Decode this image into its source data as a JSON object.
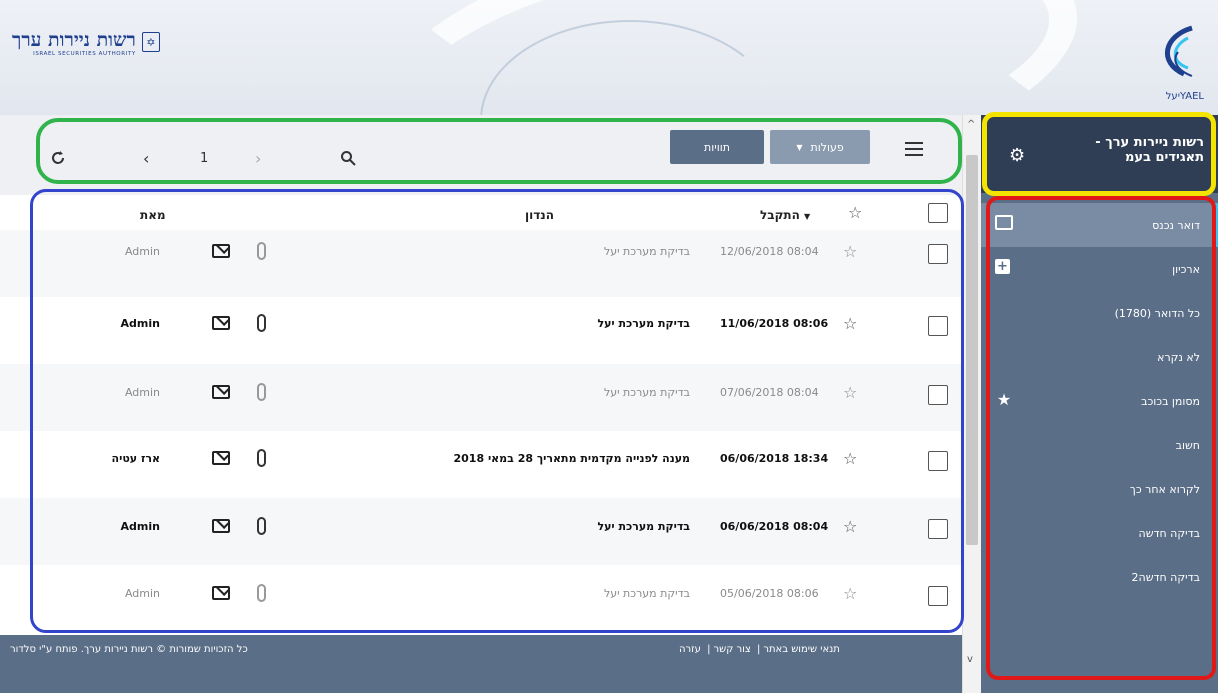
{
  "header": {
    "brand_title": "רשות ניירות ערך",
    "brand_subtitle": "ISRAEL SECURITIES AUTHORITY",
    "yael_wordmark": "יעלYAEL"
  },
  "sidebar": {
    "org_name": "רשות ניירות ערך - תאגידים בעמ",
    "settings_icon": "gear-icon",
    "folders": [
      {
        "label": "דואר נכנס",
        "icon": "envelope-icon",
        "active": true
      },
      {
        "label": "ארכיון",
        "icon": "plus-box-icon"
      },
      {
        "label": "כל הדואר (1780)"
      },
      {
        "label": "לא נקרא"
      },
      {
        "label": "מסומן בכוכב",
        "icon": "star-icon"
      },
      {
        "label": "חשוב"
      },
      {
        "label": "לקרוא אחר כך"
      },
      {
        "label": "בדיקה חדשה"
      },
      {
        "label": "בדיקה חדשה2"
      }
    ]
  },
  "toolbar": {
    "refresh_icon": "refresh-icon",
    "prev_icon": "chevron-left-icon",
    "page": "1",
    "next_icon": "chevron-right-icon",
    "search_icon": "search-icon",
    "labels_button": "תוויות",
    "actions_button": "פעולות",
    "menu_icon": "hamburger-icon"
  },
  "table": {
    "headers": {
      "from": "מאת",
      "subject": "הנדון",
      "received": "התקבל"
    },
    "rows": [
      {
        "date": "12/06/2018 08:04",
        "subject": "בדיקת מערכת יעל",
        "from": "Admin",
        "read": true
      },
      {
        "date": "11/06/2018 08:06",
        "subject": "בדיקת מערכת יעל",
        "from": "Admin",
        "read": false
      },
      {
        "date": "07/06/2018 08:04",
        "subject": "בדיקת מערכת יעל",
        "from": "Admin",
        "read": true
      },
      {
        "date": "06/06/2018 18:34",
        "subject": "מענה לפנייה מקדמית מתאריך 28 במאי 2018",
        "from": "ארז עטיה",
        "read": false
      },
      {
        "date": "06/06/2018 08:04",
        "subject": "בדיקת מערכת יעל",
        "from": "Admin",
        "read": false
      },
      {
        "date": "05/06/2018 08:06",
        "subject": "בדיקת מערכת יעל",
        "from": "Admin",
        "read": true
      }
    ]
  },
  "footer": {
    "copyright": "כל הזכויות שמורות © רשות ניירות ערך. פותח ע\"י סלדור",
    "links": [
      "תנאי שימוש באתר",
      "צור קשר",
      "עזרה"
    ]
  },
  "colors": {
    "sidebar_bg": "#5b6e87",
    "sidebar_top_bg": "#2f3d55",
    "active_indicator": "#35c5ee",
    "highlight_green": "#2fb34a",
    "highlight_blue": "#3344cc",
    "highlight_yellow": "#f4e400",
    "highlight_red": "#e01818"
  }
}
